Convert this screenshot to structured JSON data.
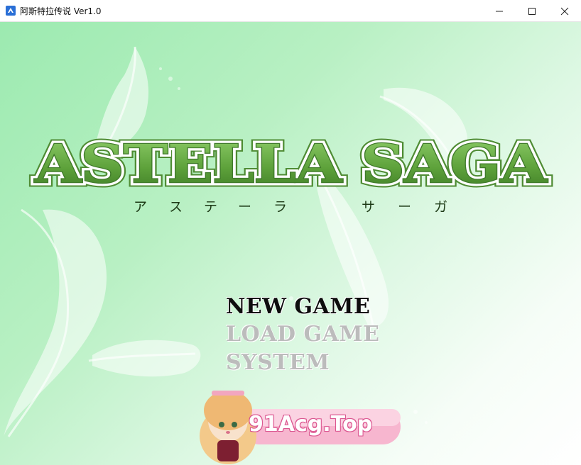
{
  "window": {
    "title": "阿斯特拉传说 Ver1.0",
    "controls": [
      "minimize",
      "maximize",
      "close"
    ]
  },
  "logo": {
    "title": "ASTELLA SAGA",
    "kana": [
      "ア",
      "ス",
      "テ",
      "ー",
      "ラ",
      "サ",
      "ー",
      "ガ"
    ]
  },
  "menu": {
    "items": [
      {
        "label": "NEW GAME",
        "state": "selected"
      },
      {
        "label": "LOAD GAME",
        "state": "disabled"
      },
      {
        "label": "SYSTEM",
        "state": "disabled"
      }
    ]
  },
  "watermark": {
    "text": "91Acg.Top"
  },
  "colors": {
    "background_start": "#9ceab0",
    "background_end": "#ffffff",
    "logo_green": "#3f7a2a",
    "menu_active": "#0d0d0d",
    "menu_inactive": "#bcbcbc",
    "watermark_pink": "#f4a8c8"
  }
}
